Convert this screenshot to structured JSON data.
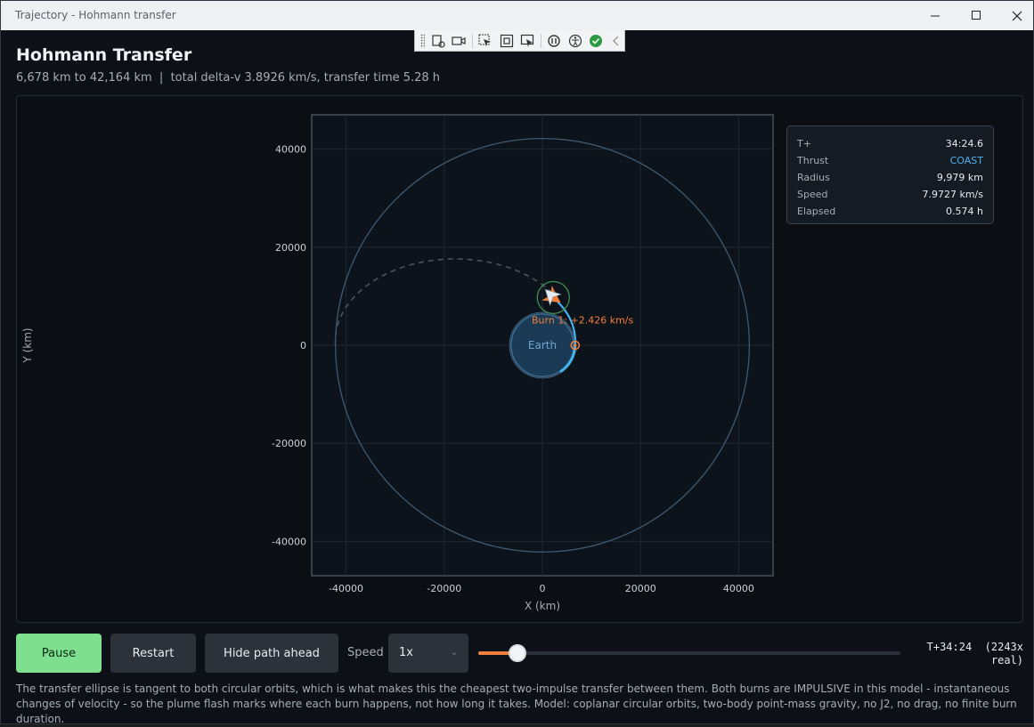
{
  "window": {
    "title": "Trajectory - Hohmann transfer"
  },
  "header": {
    "title": "Hohmann Transfer",
    "subtitle": "6,678 km to 42,164 km  |  total delta-v 3.8926 km/s, transfer time 5.28 h"
  },
  "debug_toolbar": {
    "icons": [
      "live-visual-tree-icon",
      "record-icon",
      "select-element-icon",
      "display-layout-adorners-icon",
      "track-focus-icon",
      "hot-reload-icon",
      "accessibility-icon",
      "binding-check-icon",
      "collapse-chevron-icon"
    ]
  },
  "hud": {
    "rows": [
      {
        "label": "T+",
        "value": "34:24.6"
      },
      {
        "label": "Thrust",
        "value": "COAST"
      },
      {
        "label": "Radius",
        "value": "9,979 km"
      },
      {
        "label": "Speed",
        "value": "7.9727 km/s"
      },
      {
        "label": "Elapsed",
        "value": "0.574 h"
      }
    ],
    "thrust_color": "#4fb3f0"
  },
  "chart_data": {
    "type": "scatter",
    "xlabel": "X (km)",
    "ylabel": "Y (km)",
    "xlim": [
      -47000,
      47000
    ],
    "ylim": [
      -47000,
      47000
    ],
    "xticks": [
      -40000,
      -20000,
      0,
      20000,
      40000
    ],
    "yticks": [
      40000,
      20000,
      0,
      -20000,
      -40000
    ],
    "grid": true,
    "earth": {
      "label": "Earth",
      "radius_km": 6378
    },
    "orbits": {
      "inner_radius_km": 6678,
      "outer_radius_km": 42164
    },
    "spacecraft": {
      "x": 2230,
      "y": 9727
    },
    "burn_marker": {
      "x": 6678,
      "y": 0,
      "label": "Burn 1: +2.426 km/s"
    },
    "colors": {
      "orbit": "#3e5a72",
      "transfer_dashed": "#4a5560",
      "path_flown": "#43b3ee",
      "earth_fill": "#1b3a55",
      "earth_stroke": "#3c6c94",
      "burn": "#ef7f3a",
      "focus_ring": "#3f8f56"
    }
  },
  "controls": {
    "pause_label": "Pause",
    "restart_label": "Restart",
    "hide_path_label": "Hide path ahead",
    "speed_label": "Speed",
    "speed_value": "1x",
    "timeline_fraction": 0.092,
    "timer_line1": "T+34:24  (2243x",
    "timer_line2": "real)"
  },
  "footnote": "The transfer ellipse is tangent to both circular orbits, which is what makes this the cheapest two-impulse transfer between them. Both burns are IMPULSIVE in this model - instantaneous changes of velocity - so the plume flash marks where each burn happens, not how long it takes. Model: coplanar circular orbits, two-body point-mass gravity, no J2, no drag, no finite burn duration."
}
